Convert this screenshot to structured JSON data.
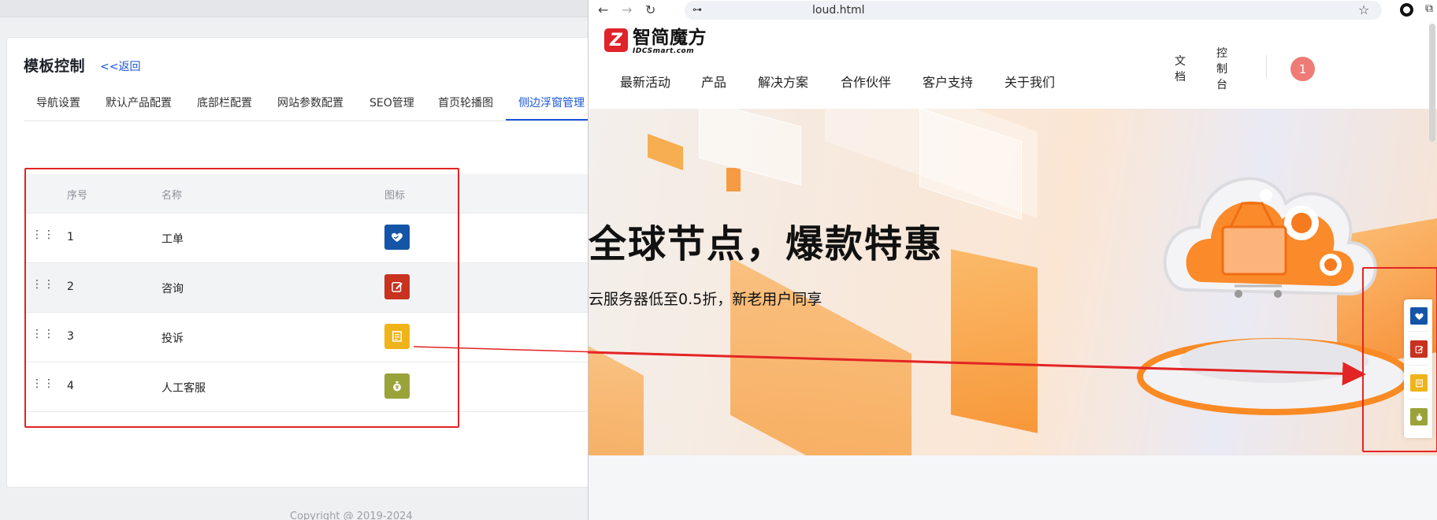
{
  "admin": {
    "title": "模板控制",
    "back_link": "<<返回",
    "tabs": [
      {
        "label": "导航设置"
      },
      {
        "label": "默认产品配置"
      },
      {
        "label": "底部栏配置"
      },
      {
        "label": "网站参数配置"
      },
      {
        "label": "SEO管理"
      },
      {
        "label": "首页轮播图"
      },
      {
        "label": "侧边浮窗管理"
      }
    ],
    "active_tab": "侧边浮窗管理",
    "table": {
      "headers": {
        "no": "序号",
        "name": "名称",
        "icon": "图标"
      },
      "rows": [
        {
          "no": "1",
          "name": "工单",
          "icon": "handshake-heart-icon",
          "color": "#1455a8"
        },
        {
          "no": "2",
          "name": "咨询",
          "icon": "edit-note-icon",
          "color": "#c8321e"
        },
        {
          "no": "3",
          "name": "投诉",
          "icon": "receipt-icon",
          "color": "#efb41a"
        },
        {
          "no": "4",
          "name": "人工客服",
          "icon": "money-bag-icon",
          "color": "#9aa33a"
        }
      ]
    },
    "copyright": "Copyright @ 2019-2024"
  },
  "browser": {
    "url": "loud.html",
    "site": {
      "logo_cn": "智简魔方",
      "logo_en": "IDCSmart.com",
      "menu": [
        "最新活动",
        "产品",
        "解决方案",
        "合作伙伴",
        "客户支持",
        "关于我们"
      ],
      "doc_label": "文档",
      "console_label": "控制台",
      "avatar_text": "1",
      "headline": "全球节点，爆款特惠",
      "subline": "云服务器低至0.5折，新老用户同享"
    }
  },
  "colors": {
    "accent_blue": "#1a56d6",
    "annotation_red": "#e32424"
  }
}
